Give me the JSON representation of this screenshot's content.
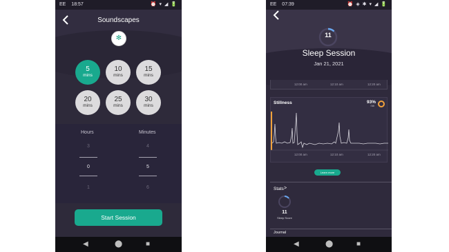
{
  "left_phone": {
    "status": {
      "carrier": "EE",
      "time": "18:57",
      "icons": "⏰ ▾ ◢ 🔋"
    },
    "title": "Soundscapes",
    "bluetooth_glyph": "✻",
    "durations": [
      {
        "value": "5",
        "unit": "mins",
        "selected": true
      },
      {
        "value": "10",
        "unit": "mins",
        "selected": false
      },
      {
        "value": "15",
        "unit": "mins",
        "selected": false
      },
      {
        "value": "20",
        "unit": "mins",
        "selected": false
      },
      {
        "value": "25",
        "unit": "mins",
        "selected": false
      },
      {
        "value": "30",
        "unit": "mins",
        "selected": false
      }
    ],
    "picker": {
      "hours_label": "Hours",
      "minutes_label": "Minutes",
      "hours": {
        "prev": "3",
        "current": "0",
        "next": "1"
      },
      "minutes": {
        "prev": "4",
        "current": "5",
        "next": "6"
      }
    },
    "start_button": "Start Session"
  },
  "right_phone": {
    "status": {
      "carrier": "EE",
      "time": "07:39",
      "icons": "⏰ ◈ ✱ ▾ ◢ 🔋"
    },
    "sleep_score": "11",
    "title": "Sleep Session",
    "date": "Jan 21, 2021",
    "top_axis_ticks": [
      "12:00 am",
      "12:10 am",
      "12:20 am"
    ],
    "stillness": {
      "title": "Stillness",
      "percent": "93%",
      "sub_label": "Still",
      "axis_ticks": [
        "12:00 am",
        "12:10 am",
        "12:20 am"
      ],
      "learn_more": "Learn more"
    },
    "stats_label": "Stats",
    "stats_chevron": ">",
    "mini_score": "11",
    "mini_score_label": "Sleep Score",
    "journal_label": "Journal"
  },
  "nav": {
    "back": "◀",
    "home": "⬤",
    "recent": "■"
  },
  "colors": {
    "accent": "#19a98e",
    "background": "#2e2a3a",
    "stillness_ring": "#f2a23b"
  }
}
